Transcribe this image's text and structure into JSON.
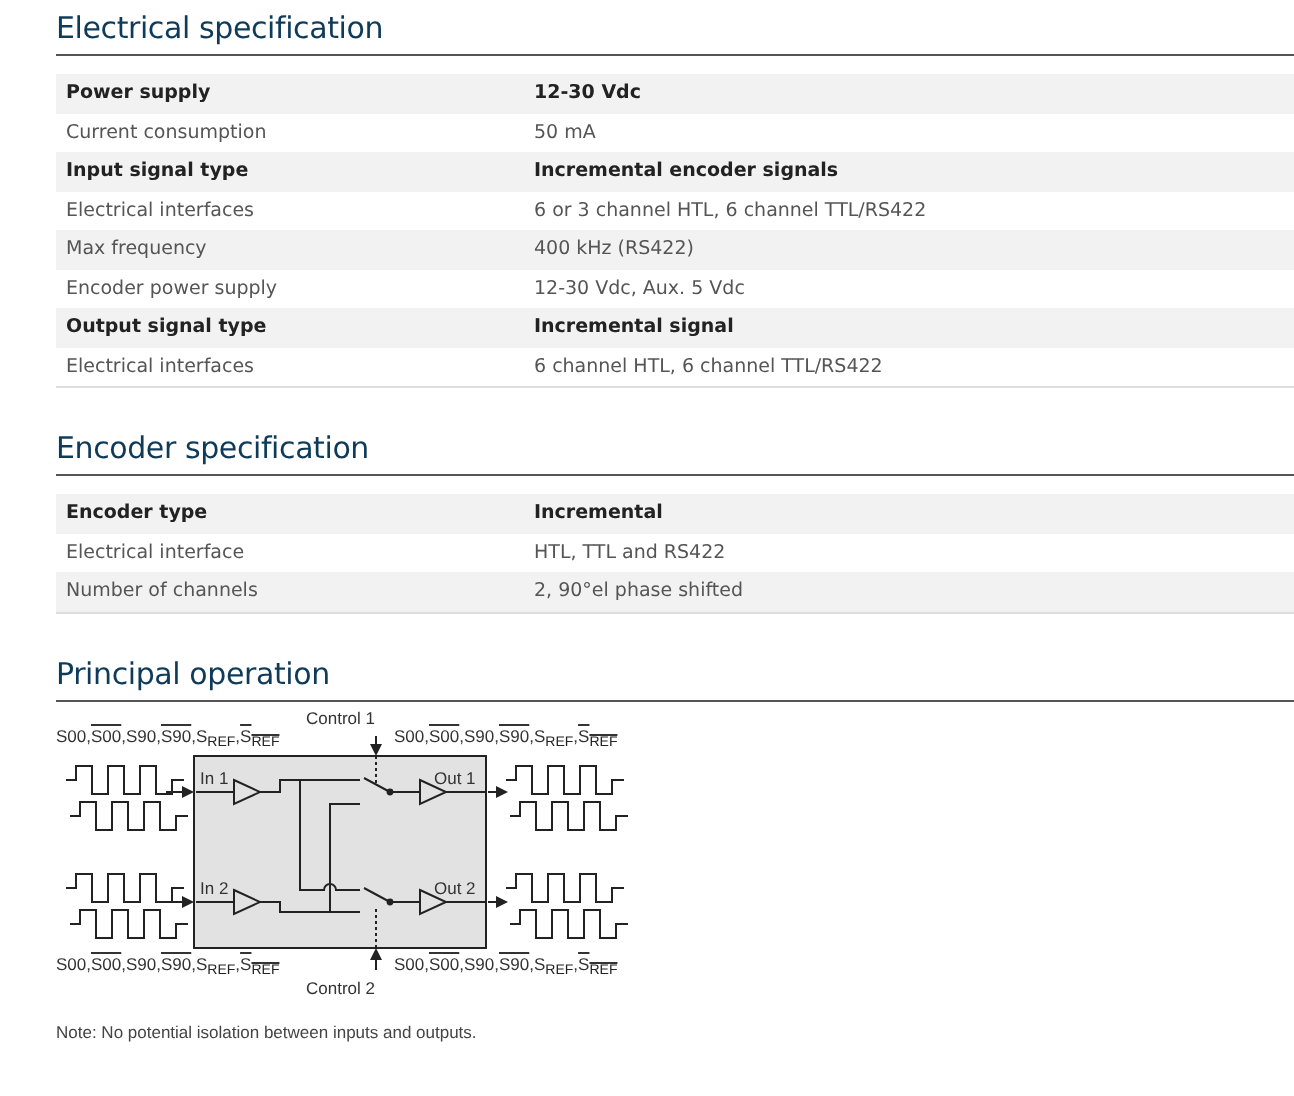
{
  "sections": [
    {
      "title": "Electrical specification",
      "rows": [
        {
          "label": "Power supply",
          "value": "12-30 Vdc",
          "bold": true
        },
        {
          "label": "Current consumption",
          "value": "50 mA",
          "bold": false
        },
        {
          "label": "Input signal type",
          "value": "Incremental encoder signals",
          "bold": true
        },
        {
          "label": "Electrical interfaces",
          "value": "6 or 3 channel HTL, 6 channel TTL/RS422",
          "bold": false
        },
        {
          "label": "Max frequency",
          "value": "400 kHz (RS422)",
          "bold": false
        },
        {
          "label": "Encoder power supply",
          "value": "12-30 Vdc, Aux. 5 Vdc",
          "bold": false
        },
        {
          "label": "Output signal type",
          "value": "Incremental signal",
          "bold": true
        },
        {
          "label": "Electrical interfaces",
          "value": "6 channel HTL, 6 channel TTL/RS422",
          "bold": false
        }
      ]
    },
    {
      "title": "Encoder specification",
      "rows": [
        {
          "label": "Encoder type",
          "value": "Incremental",
          "bold": true
        },
        {
          "label": "Electrical interface",
          "value": "HTL, TTL and RS422",
          "bold": false
        },
        {
          "label": "Number of channels",
          "value": "2, 90°el phase shifted",
          "bold": false
        }
      ]
    }
  ],
  "operation": {
    "title": "Principal operation",
    "controls": [
      "Control 1",
      "Control 2"
    ],
    "inputs": [
      "In 1",
      "In 2"
    ],
    "outputs": [
      "Out 1",
      "Out 2"
    ],
    "signal_labels": [
      [
        {
          "text": "S00",
          "sep": ","
        },
        {
          "text": "S00",
          "sep": ",",
          "overline": true
        },
        {
          "text": "S90",
          "sep": ","
        },
        {
          "text": "S90",
          "sep": ",",
          "overline": true
        },
        {
          "text": "S",
          "sub": "REF",
          "sep": ","
        },
        {
          "text": "S",
          "sub": "REF",
          "overline": true
        }
      ],
      [
        {
          "text": "S00",
          "sep": ","
        },
        {
          "text": "S00",
          "sep": ",",
          "overline": true
        },
        {
          "text": "S90",
          "sep": ","
        },
        {
          "text": "S90",
          "sep": ",",
          "overline": true
        },
        {
          "text": "S",
          "sub": "REF",
          "sep": ","
        },
        {
          "text": "S",
          "sub": "REF",
          "overline": true
        }
      ],
      [
        {
          "text": "S00",
          "sep": ","
        },
        {
          "text": "S00",
          "sep": ",",
          "overline": true
        },
        {
          "text": "S90",
          "sep": ","
        },
        {
          "text": "S90",
          "sep": ",",
          "overline": true
        },
        {
          "text": "S",
          "sub": "REF",
          "sep": ","
        },
        {
          "text": "S",
          "sub": "REF",
          "overline": true
        }
      ],
      [
        {
          "text": "S00",
          "sep": ","
        },
        {
          "text": "S00",
          "sep": ",",
          "overline": true
        },
        {
          "text": "S90",
          "sep": ","
        },
        {
          "text": "S90",
          "sep": ",",
          "overline": true
        },
        {
          "text": "S",
          "sub": "REF",
          "sep": ","
        },
        {
          "text": "S",
          "sub": "REF",
          "overline": true
        }
      ]
    ],
    "note": "Note: No potential isolation between inputs and outputs."
  }
}
